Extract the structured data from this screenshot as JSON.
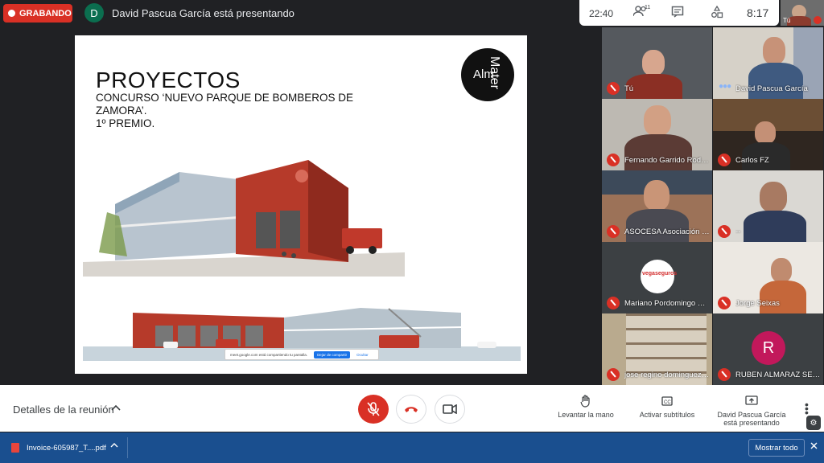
{
  "header": {
    "recording_label": "GRABANDO",
    "presenter_initial": "D",
    "presenter_text": "David Pascua García está presentando",
    "elapsed_time": "22:40",
    "participants_count": "11",
    "clock": "8:17",
    "self_label": "Tú"
  },
  "slide": {
    "title": "PROYECTOS",
    "subtitle_line1": "CONCURSO ‘NUEVO PARQUE DE BOMBEROS DE",
    "subtitle_line2": "ZAMORA’.",
    "subtitle_line3": "1º PREMIO.",
    "logo_word1": "Alm",
    "logo_word2": "Mater",
    "share_notice": "meet.google.com está compartiendo tu pantalla.",
    "share_stop_label": "Dejar de compartir",
    "share_hide_label": "Ocultar"
  },
  "participants": [
    {
      "name": "Tú",
      "muted": true,
      "bg": "#4a4a4a"
    },
    {
      "name": "David Pascua García",
      "muted": false,
      "bg": "#c9c4bb"
    },
    {
      "name": "Fernando Garrido Rodri…",
      "muted": true,
      "bg": "#a8a5a0"
    },
    {
      "name": "Carlos FZ",
      "muted": true,
      "bg": "#3a2e26"
    },
    {
      "name": "ASOCESA Asociación E…",
      "muted": true,
      "bg": "#8c6a55"
    },
    {
      "name": "--",
      "muted": true,
      "bg": "#d7d5d0"
    },
    {
      "name": "Mariano Pordomingo R…",
      "muted": true,
      "bg": "#3c4043",
      "logo_text": "vegaseguros"
    },
    {
      "name": "Jorge Seixas",
      "muted": true,
      "bg": "#ece8e2"
    },
    {
      "name": "jose regino dominguez…",
      "muted": true,
      "bg": "#b9aa8e"
    },
    {
      "name": "RUBEN ALMARAZ SEVI…",
      "muted": true,
      "bg": "#3c4043",
      "initial": "R"
    }
  ],
  "controls": {
    "meeting_details": "Detalles de la reunión",
    "raise_hand": "Levantar la mano",
    "captions": "Activar subtítulos",
    "presenting_line1": "David Pascua García",
    "presenting_line2": "está presentando"
  },
  "downloads": {
    "file_name": "Invoice-605987_T....pdf",
    "show_all": "Mostrar todo"
  },
  "colors": {
    "red": "#d93025",
    "meet_dark": "#202124",
    "download_bar": "#1a4f8f"
  }
}
